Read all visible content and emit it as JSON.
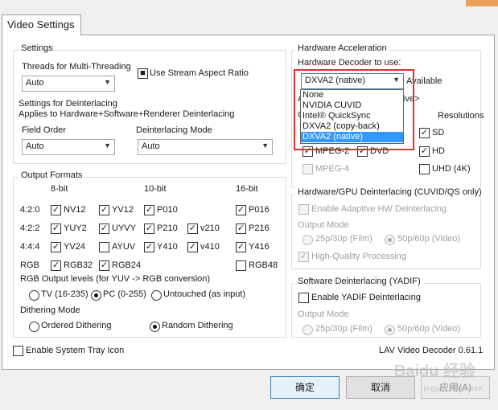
{
  "tab_label": "Video Settings",
  "settings": {
    "title": "Settings",
    "threads_label": "Threads for Multi-Threading",
    "threads_value": "Auto",
    "stream_aspect_label": "Use Stream Aspect Ratio",
    "deint_label": "Settings for Deinterlacing",
    "deint_sub": "Applies to Hardware+Software+Renderer Deinterlacing",
    "field_order_label": "Field Order",
    "field_order_value": "Auto",
    "deint_mode_label": "Deinterlacing Mode",
    "deint_mode_value": "Auto"
  },
  "output_formats": {
    "title": "Output Formats",
    "col_headers": [
      "8-bit",
      "10-bit",
      "16-bit"
    ],
    "rows": [
      {
        "label": "4:2:0",
        "items": [
          {
            "text": "NV12",
            "checked": true
          },
          {
            "text": "YV12",
            "checked": true
          },
          {
            "text": "P010",
            "checked": true
          },
          {
            "text": "",
            "checked": false
          },
          {
            "text": "P016",
            "checked": true
          }
        ]
      },
      {
        "label": "4:2:2",
        "items": [
          {
            "text": "YUY2",
            "checked": true
          },
          {
            "text": "UYVY",
            "checked": true
          },
          {
            "text": "P210",
            "checked": true
          },
          {
            "text": "v210",
            "checked": true
          },
          {
            "text": "P216",
            "checked": true
          }
        ]
      },
      {
        "label": "4:4:4",
        "items": [
          {
            "text": "YV24",
            "checked": true
          },
          {
            "text": "AYUV",
            "checked": false
          },
          {
            "text": "Y410",
            "checked": true
          },
          {
            "text": "v410",
            "checked": true
          },
          {
            "text": "Y416",
            "checked": true
          }
        ]
      },
      {
        "label": "RGB",
        "items": [
          {
            "text": "RGB32",
            "checked": true
          },
          {
            "text": "RGB24",
            "checked": true
          },
          {
            "text": "",
            "checked": false
          },
          {
            "text": "",
            "checked": false
          },
          {
            "text": "RGB48",
            "checked": false
          }
        ]
      }
    ],
    "rgb_levels_label": "RGB Output levels (for YUV -> RGB conversion)",
    "rgb_levels": [
      {
        "text": "TV (16-235)",
        "selected": false
      },
      {
        "text": "PC (0-255)",
        "selected": true
      },
      {
        "text": "Untouched (as input)",
        "selected": false
      }
    ],
    "dither_label": "Dithering Mode",
    "dither": [
      {
        "text": "Ordered Dithering",
        "selected": false
      },
      {
        "text": "Random Dithering",
        "selected": true
      }
    ]
  },
  "tray_label": "Enable System Tray Icon",
  "hw": {
    "title": "Hardware Acceleration",
    "decoder_label": "Hardware Decoder to use:",
    "decoder_value": "DXVA2 (native)",
    "available": "Available",
    "partial_a": "A",
    "partial_c": "C",
    "partial_native": "ive>",
    "resolutions": "Resolutions",
    "options": [
      "None",
      "NVIDIA CUVID",
      "Intel® QuickSync",
      "DXVA2 (copy-back)",
      "DXVA2 (native)"
    ],
    "selected_index": 4,
    "codecs": [
      {
        "text": "MPEG-2",
        "checked": true,
        "disabled": false
      },
      {
        "text": "DVD",
        "checked": true,
        "disabled": false
      },
      {
        "text": "MPEG-4",
        "checked": false,
        "disabled": true
      }
    ],
    "res": [
      {
        "text": "SD",
        "checked": true
      },
      {
        "text": "HD",
        "checked": true
      },
      {
        "text": "UHD (4K)",
        "checked": false
      }
    ]
  },
  "hwdeint": {
    "title": "Hardware/GPU Deinterlacing (CUVID/QS only)",
    "adaptive": "Enable Adaptive HW Deinterlacing",
    "output_mode": "Output Mode",
    "film": "25p/30p (Film)",
    "video": "50p/60p (Video)",
    "hq": "High-Quality Processing"
  },
  "swdeint": {
    "title": "Software Deinterlacing (YADIF)",
    "enable": "Enable YADIF Deinterlacing",
    "output_mode": "Output Mode",
    "film": "25p/30p (Film)",
    "video": "50p/60p (Video)"
  },
  "version": "LAV Video Decoder 0.61.1",
  "buttons": {
    "ok": "确定",
    "cancel": "取消",
    "apply": "应用(A)"
  },
  "watermark": {
    "main": "Baidu 经验",
    "sub": "jingyan.baidu.com"
  },
  "colors": {
    "accent": "#3399ff",
    "highlight_box": "#e03030"
  }
}
